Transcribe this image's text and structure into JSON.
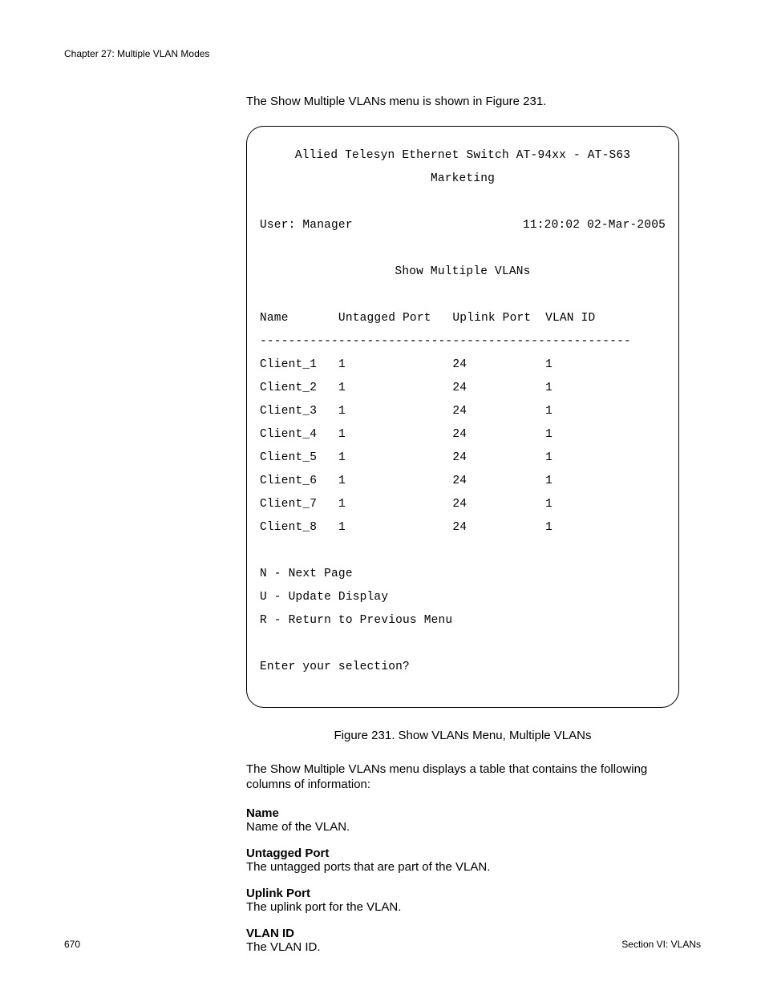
{
  "header": {
    "chapter": "Chapter 27: Multiple VLAN Modes"
  },
  "intro": "The Show Multiple VLANs menu is shown in Figure 231.",
  "terminal": {
    "title1": "Allied Telesyn Ethernet Switch AT-94xx - AT-S63",
    "title2": "Marketing",
    "user": "User: Manager",
    "datetime": "11:20:02 02-Mar-2005",
    "heading": "Show Multiple VLANs",
    "col_name": "Name",
    "col_untagged": "Untagged Port",
    "col_uplink": "Uplink Port",
    "col_vlanid": "VLAN ID",
    "sep": "----------------------------------------------------",
    "rows": [
      {
        "name": "Client_1",
        "untagged": "1",
        "uplink": "24",
        "vlanid": "1"
      },
      {
        "name": "Client_2",
        "untagged": "1",
        "uplink": "24",
        "vlanid": "1"
      },
      {
        "name": "Client_3",
        "untagged": "1",
        "uplink": "24",
        "vlanid": "1"
      },
      {
        "name": "Client_4",
        "untagged": "1",
        "uplink": "24",
        "vlanid": "1"
      },
      {
        "name": "Client_5",
        "untagged": "1",
        "uplink": "24",
        "vlanid": "1"
      },
      {
        "name": "Client_6",
        "untagged": "1",
        "uplink": "24",
        "vlanid": "1"
      },
      {
        "name": "Client_7",
        "untagged": "1",
        "uplink": "24",
        "vlanid": "1"
      },
      {
        "name": "Client_8",
        "untagged": "1",
        "uplink": "24",
        "vlanid": "1"
      }
    ],
    "opt_n": "N - Next Page",
    "opt_u": "U - Update Display",
    "opt_r": "R - Return to Previous Menu",
    "prompt": "Enter your selection?"
  },
  "caption": "Figure 231. Show VLANs Menu, Multiple VLANs",
  "body1": "The Show Multiple VLANs menu displays a table that contains the following columns of information:",
  "defs": {
    "name_t": "Name",
    "name_d": "Name of the VLAN.",
    "untagged_t": "Untagged Port",
    "untagged_d": "The untagged ports that are part of the VLAN.",
    "uplink_t": "Uplink Port",
    "uplink_d": "The uplink port for the VLAN.",
    "vlanid_t": "VLAN ID",
    "vlanid_d": "The VLAN ID."
  },
  "footer": {
    "page": "670",
    "section": "Section VI: VLANs"
  }
}
